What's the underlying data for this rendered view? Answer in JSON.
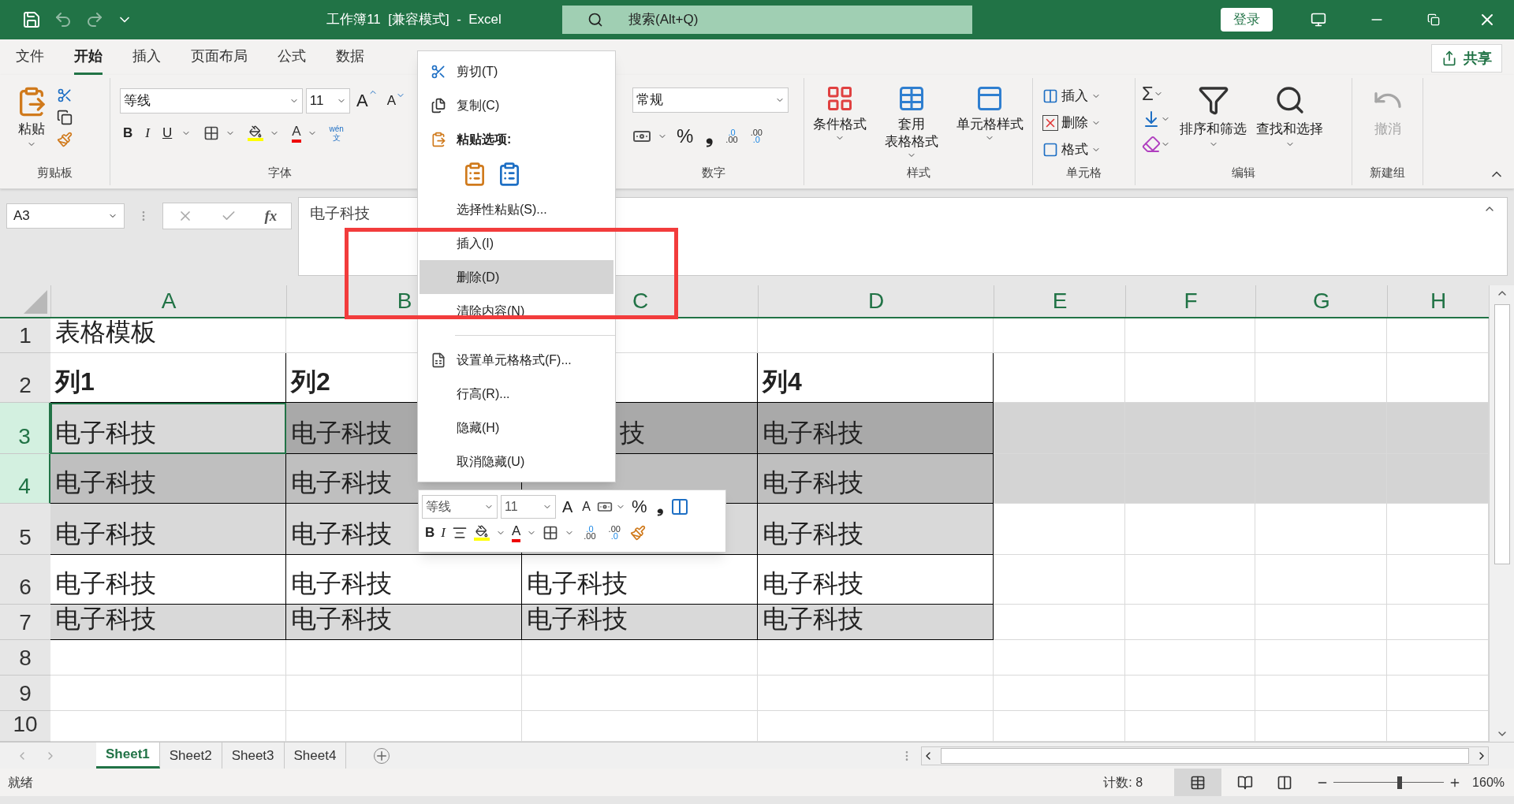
{
  "title_bar": {
    "title": "工作簿11  [兼容模式]  -  Excel",
    "search": {
      "placeholder": "搜索(Alt+Q)"
    },
    "login": "登录"
  },
  "tabs": [
    {
      "label": "文件",
      "selected": false
    },
    {
      "label": "开始",
      "selected": true
    },
    {
      "label": "插入",
      "selected": false
    },
    {
      "label": "页面布局",
      "selected": false
    },
    {
      "label": "公式",
      "selected": false
    },
    {
      "label": "数据",
      "selected": false
    }
  ],
  "share": "共享",
  "ribbon": {
    "paste": "粘贴",
    "clipboard_label": "剪贴板",
    "font": "等线",
    "font_size": "11",
    "grow": "A",
    "shrink": "A",
    "bold": "B",
    "italic": "I",
    "underline": "U",
    "font_color": "A",
    "phonetic": [
      "wén",
      "文"
    ],
    "font_label": "字体",
    "number_format": "常规",
    "percent": "%",
    "comma": "❟",
    "decimals": [
      [
        ".0",
        ".00"
      ],
      [
        ".00",
        ".0"
      ]
    ],
    "number_label": "数字",
    "styles": [
      [
        "条件格式"
      ],
      [
        "套用",
        "表格格式"
      ],
      [
        "单元格样式"
      ]
    ],
    "styles_label": "样式",
    "cells": [
      "插入",
      "删除",
      "格式"
    ],
    "cells_label": "单元格",
    "sigma": "Σ",
    "editing": [
      "排序和筛选",
      "查找和选择"
    ],
    "editing_label": "编辑",
    "undo": {
      "label": "撤消",
      "disabled": true
    },
    "new_group_label": "新建组"
  },
  "formula_bar": {
    "name_box": "A3",
    "fx": "fx",
    "formula": "电子科技"
  },
  "columns": [
    {
      "label": "A"
    },
    {
      "label": "B"
    },
    {
      "label": "C"
    },
    {
      "label": "D"
    },
    {
      "label": "E"
    },
    {
      "label": "F"
    },
    {
      "label": "G"
    },
    {
      "label": "H"
    }
  ],
  "rows": [
    {
      "header": "1",
      "kind": "title",
      "selected": false,
      "cells": [
        {
          "text": "表格模板",
          "active": false
        }
      ]
    },
    {
      "header": "2",
      "kind": "header",
      "selected": false,
      "banded": false,
      "cells": [
        {
          "text": "列1",
          "active": false
        },
        {
          "text": "列2",
          "active": false
        },
        {
          "text": "",
          "active": false
        },
        {
          "text": "列4",
          "active": false
        }
      ]
    },
    {
      "header": "3",
      "kind": "data",
      "selected": true,
      "banded": true,
      "cells": [
        {
          "text": "电子科技",
          "active": true
        },
        {
          "text": "电子科技",
          "active": false
        },
        {
          "text": "技",
          "active": false,
          "clipped": true
        },
        {
          "text": "电子科技",
          "active": false
        }
      ]
    },
    {
      "header": "4",
      "kind": "data",
      "selected": true,
      "banded": false,
      "cells": [
        {
          "text": "电子科技",
          "active": false
        },
        {
          "text": "电子科技",
          "active": false
        },
        {
          "text": "",
          "active": false
        },
        {
          "text": "电子科技",
          "active": false
        }
      ]
    },
    {
      "header": "5",
      "kind": "data",
      "selected": false,
      "banded": true,
      "cells": [
        {
          "text": "电子科技",
          "active": false
        },
        {
          "text": "电子科技",
          "active": false
        },
        {
          "text": "",
          "active": false
        },
        {
          "text": "电子科技",
          "active": false
        }
      ]
    },
    {
      "header": "6",
      "kind": "data",
      "selected": false,
      "banded": false,
      "cells": [
        {
          "text": "电子科技",
          "active": false
        },
        {
          "text": "电子科技",
          "active": false
        },
        {
          "text": "电子科技",
          "active": false
        },
        {
          "text": "电子科技",
          "active": false
        }
      ]
    },
    {
      "header": "7",
      "kind": "data",
      "selected": false,
      "banded": true,
      "cells": [
        {
          "text": "电子科技",
          "active": false
        },
        {
          "text": "电子科技",
          "active": false
        },
        {
          "text": "电子科技",
          "active": false
        },
        {
          "text": "电子科技",
          "active": false
        }
      ]
    },
    {
      "header": "8",
      "kind": "empty",
      "selected": false,
      "cells": []
    },
    {
      "header": "9",
      "kind": "empty",
      "selected": false,
      "cells": []
    },
    {
      "header": "10",
      "kind": "empty",
      "selected": false,
      "cells": []
    }
  ],
  "context_menu": [
    {
      "kind": "item",
      "label": "剪切(T)",
      "selected": false
    },
    {
      "kind": "item",
      "label": "复制(C)",
      "selected": false
    },
    {
      "kind": "heading",
      "label": "粘贴选项:"
    },
    {
      "kind": "paste_icons"
    },
    {
      "kind": "item",
      "label": "选择性粘贴(S)...",
      "selected": false
    },
    {
      "kind": "item",
      "label": "插入(I)",
      "selected": false
    },
    {
      "kind": "item",
      "label": "删除(D)",
      "selected": true
    },
    {
      "kind": "item",
      "label": "清除内容(N)",
      "selected": false
    },
    {
      "kind": "separator"
    },
    {
      "kind": "item",
      "label": "设置单元格格式(F)...",
      "selected": false
    },
    {
      "kind": "item",
      "label": "行高(R)...",
      "selected": false
    },
    {
      "kind": "item",
      "label": "隐藏(H)",
      "selected": false
    },
    {
      "kind": "item",
      "label": "取消隐藏(U)",
      "selected": false
    }
  ],
  "mini_toolbar": {
    "font": "等线",
    "size": "11",
    "grow": "A",
    "shrink": "A",
    "percent": "%",
    "comma": "❟",
    "bold": "B",
    "italic": "I",
    "font_color": "A",
    "decimals": [
      [
        ".0",
        ".00"
      ],
      [
        ".00",
        ".0"
      ]
    ]
  },
  "sheets": [
    {
      "label": "Sheet1",
      "selected": true
    },
    {
      "label": "Sheet2",
      "selected": false
    },
    {
      "label": "Sheet3",
      "selected": false
    },
    {
      "label": "Sheet4",
      "selected": false
    }
  ],
  "status_bar": {
    "status": "就绪",
    "count": "计数: 8",
    "zoom": {
      "level": 0.6,
      "reading": "160%"
    }
  }
}
